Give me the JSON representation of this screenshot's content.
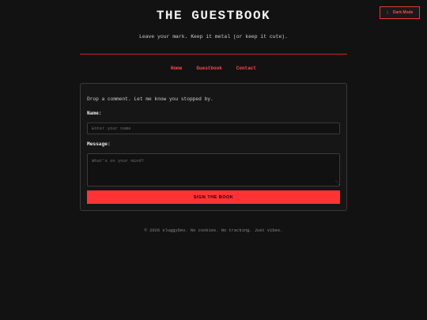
{
  "toggle": {
    "icon": "moon-icon",
    "label": "Dark Mode"
  },
  "header": {
    "title": "THE GUESTBOOK",
    "tagline": "Leave your mark. Keep it metal (or keep it cute)."
  },
  "nav": [
    {
      "label": "Home"
    },
    {
      "label": "Guestbook"
    },
    {
      "label": "Contact"
    }
  ],
  "form": {
    "intro": "Drop a comment. Let me know you stopped by.",
    "name_label": "Name:",
    "name_placeholder": "Enter your name",
    "name_value": "",
    "message_label": "Message:",
    "message_placeholder": "What's on your mind?",
    "message_value": "",
    "submit_label": "SIGN THE BOOK"
  },
  "footer": {
    "text": "© 2026 sluggyDev. No cookies. No tracking. Just vibes."
  },
  "colors": {
    "background": "#121212",
    "accent": "#ff3333",
    "border": "#3a3a3a",
    "text": "#dddddd"
  }
}
